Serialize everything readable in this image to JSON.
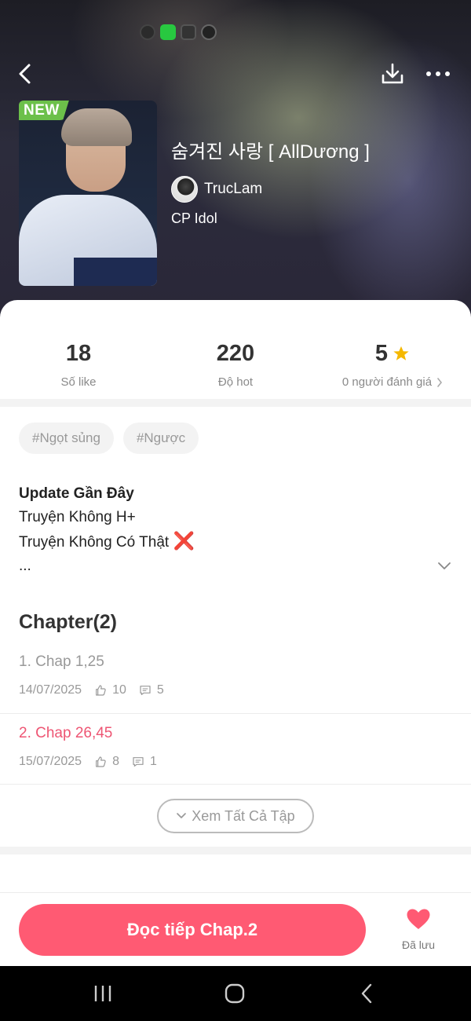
{
  "header": {
    "badge": "NEW",
    "title": "숨겨진 사랑 [ AllDương ]",
    "author": "TrucLam",
    "category": "CP Idol"
  },
  "stats": [
    {
      "value": "18",
      "label": "Số like"
    },
    {
      "value": "220",
      "label": "Độ hot"
    },
    {
      "value": "5",
      "label": "0 người đánh giá",
      "rating_icon": "star-icon"
    }
  ],
  "tags": [
    "#Ngọt sủng",
    "#Ngược"
  ],
  "description": {
    "line1": "Update Gần Đây",
    "line2": "Truyện Không H+",
    "line3": "Truyện Không Có Thật",
    "line3_mark": "❌",
    "line4": "..."
  },
  "chapters": {
    "heading": "Chapter(2)",
    "items": [
      {
        "title": "1. Chap 1,25",
        "date": "14/07/2025",
        "likes": "10",
        "comments": "5"
      },
      {
        "title": "2. Chap 26,45",
        "date": "15/07/2025",
        "likes": "8",
        "comments": "1"
      }
    ],
    "see_all": "Xem Tất Cả Tập"
  },
  "footer": {
    "read_button": "Đọc tiếp Chap.2",
    "saved_label": "Đã lưu"
  },
  "colors": {
    "accent": "#ff5a73",
    "active_chapter": "#ee5573",
    "badge": "#6cc04a",
    "star": "#f5b800"
  }
}
